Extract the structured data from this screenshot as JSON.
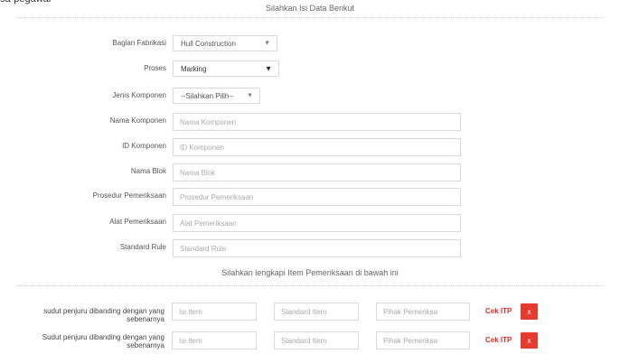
{
  "cut_text": "sa-pegawai",
  "header": {
    "title": "Silahkan Isi Data Berikut"
  },
  "form": {
    "bagian_fabrikasi": {
      "label": "Bagian Fabrikasi",
      "value": "Hull Construction"
    },
    "proses": {
      "label": "Proses",
      "value": "Marking"
    },
    "jenis_komponen": {
      "label": "Jenis Komponen",
      "value": "--Silahkan Pilih--"
    },
    "nama_komponen": {
      "label": "Nama Komponen",
      "placeholder": "Nama Komponen"
    },
    "id_komponen": {
      "label": "ID Komponen",
      "placeholder": "ID Komponen"
    },
    "nama_blok": {
      "label": "Nama Blok",
      "placeholder": "Nama Blok"
    },
    "prosedur_pemeriksaan": {
      "label": "Prosedur Pemeriksaan",
      "placeholder": "Prosedur Pemeriksaan"
    },
    "alat_pemeriksaan": {
      "label": "Alat Pemeriksaan",
      "placeholder": "Alat Pemeriksaan"
    },
    "standard_rule": {
      "label": "Standard Rule",
      "placeholder": "Standard Rule"
    }
  },
  "items_section": {
    "title": "Silahkan lengkapi Item Pemeriksaan di bawah ini",
    "rows": [
      {
        "label": "sudut penjuru dibanding dengan yang sebenarnya",
        "isi_placeholder": "Isi Item",
        "standard_placeholder": "Standard Item",
        "pihak_placeholder": "Pihak Pemeriksa",
        "cek_label": "Cek ITP",
        "remove_label": "x"
      },
      {
        "label": "Sudut penjuru dibanding dengan yang sebenarnya",
        "isi_placeholder": "Isi Item",
        "standard_placeholder": "Standard Item",
        "pihak_placeholder": "Pihak Pemeriksa",
        "cek_label": "Cek ITP",
        "remove_label": "x"
      }
    ]
  },
  "colors": {
    "accent_red": "#e53c2f",
    "cek_text": "#d9302c",
    "border": "#d9d9d9"
  }
}
